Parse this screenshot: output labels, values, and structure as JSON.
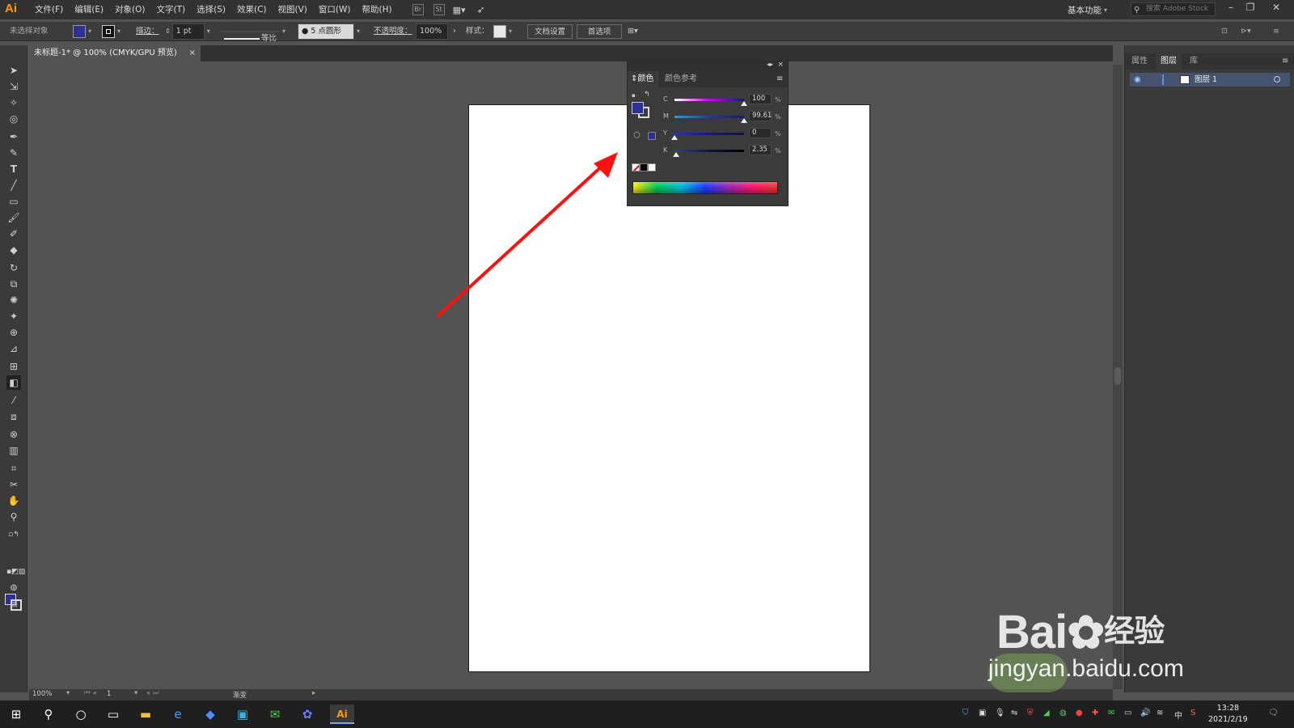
{
  "app": {
    "logo": "Ai"
  },
  "menu": {
    "items": [
      "文件(F)",
      "编辑(E)",
      "对象(O)",
      "文字(T)",
      "选择(S)",
      "效果(C)",
      "视图(V)",
      "窗口(W)",
      "帮助(H)"
    ],
    "bridge_icon": "Br",
    "stock_icon": "St",
    "workspace": "基本功能",
    "stock_search_placeholder": "搜索 Adobe Stock"
  },
  "control_bar": {
    "selection": "未选择对象",
    "stroke_label": "描边：",
    "stroke_weight": "1 pt",
    "stroke_profile": "等比",
    "brush": "5 点圆形",
    "opacity_label": "不透明度：",
    "opacity_value": "100%",
    "style_label": "样式：",
    "doc_setup": "文档设置",
    "preferences": "首选项"
  },
  "document": {
    "tab_title": "未标题-1* @ 100% (CMYK/GPU 预览)",
    "close": "×"
  },
  "status_bar": {
    "zoom": "100%",
    "artboard_index": "1",
    "tool_status": "渐变"
  },
  "color_panel": {
    "tab_color": "颜色",
    "tab_color_guide": "颜色参考",
    "collapse": "◂▸",
    "close": "×",
    "menu": "≡",
    "channels": [
      {
        "label": "C",
        "value": "100",
        "level": 1.0,
        "gradient": "linear-gradient(to right,#ffffff,#c000ff,#1a1a6e)"
      },
      {
        "label": "M",
        "value": "99.61",
        "level": 0.996,
        "gradient": "linear-gradient(to right,#00aaff,#2233cc,#1a1a6e)"
      },
      {
        "label": "Y",
        "value": "0",
        "level": 0.0,
        "gradient": "linear-gradient(to right,#1f3aa8,#1a1a6e,#111144)"
      },
      {
        "label": "K",
        "value": "2.35",
        "level": 0.0235,
        "gradient": "linear-gradient(to right,#2b3bb8,#141440,#000000)"
      }
    ],
    "percent": "%",
    "fill_color": "#2e3192"
  },
  "layers_panel": {
    "tabs": [
      "属性",
      "图层",
      "库"
    ],
    "active_tab": "图层",
    "layer_name": "图层 1"
  },
  "watermark": {
    "brand": "Bai",
    "brand_cn": "经验",
    "site": "jingyan.baidu.com"
  },
  "taskbar": {
    "time": "13:28",
    "date": "2021/2/19",
    "ime": "中"
  }
}
